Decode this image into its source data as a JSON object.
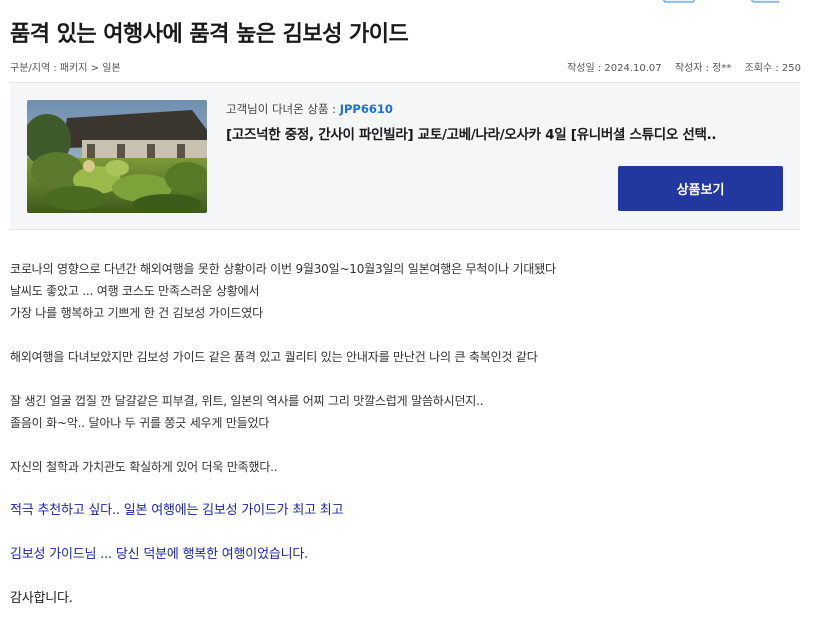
{
  "review": {
    "title": "품격 있는 여행사에 품격 높은 김보성 가이드",
    "category": "구분/지역 : 패키지 > 일본",
    "date_label": "작성일 : 2024.10.07",
    "author_label": "작성자 : 정**",
    "views_label": "조회수 : 250"
  },
  "product": {
    "label": "고객님이 다녀온 상품 : ",
    "code": "JPP6610",
    "name": "[고즈넉한 중정, 간사이 파인빌라] 교토/고베/나라/오사카 4일 [유니버셜 스튜디오 선택..",
    "button_label": "상품보기",
    "image_icon": "japanese-garden-photo"
  },
  "content": {
    "p1_l1": "코로나의 영향으로 다년간 해외여행을 못한 상황이라 이번 9월30일~10월3일의 일본여행은 무척이나 기대됐다",
    "p1_l2": "날씨도 좋았고 ... 여행 코스도 만족스러운 상황에서",
    "p1_l3": "가장 나를 행복하고 기쁘게 한 건 김보성 가이드였다",
    "p2": "해외여행을 다녀보았지만 김보성 가이드 같은 품격 있고 퀄리티 있는 안내자를 만난건 나의 큰 축복인것 같다",
    "p3_l1": "잘 생긴 얼굴 껍질 깐 달걀같은 피부결, 위트,  일본의 역사를 어찌 그리 맛깔스럽게 말씀하시던지..",
    "p3_l2": "졸음이 화~악.. 달아나 두 귀를 쫑긋 세우게 만들었다",
    "p4": "자신의 철학과 가치관도 확실하게  있어 더욱 만족했다..",
    "p5": " 적극 추천하고 싶다.. 일본 여행에는 김보성 가이드가 최고 최고",
    "p6": " 김보성 가이드님 ... 당신 덕분에 행복한 여행이었습니다.",
    "p7": "감사합니다."
  },
  "colors": {
    "accent": "#22389f",
    "code": "#1a6fd8",
    "highlight_text": "#1b25a8"
  }
}
